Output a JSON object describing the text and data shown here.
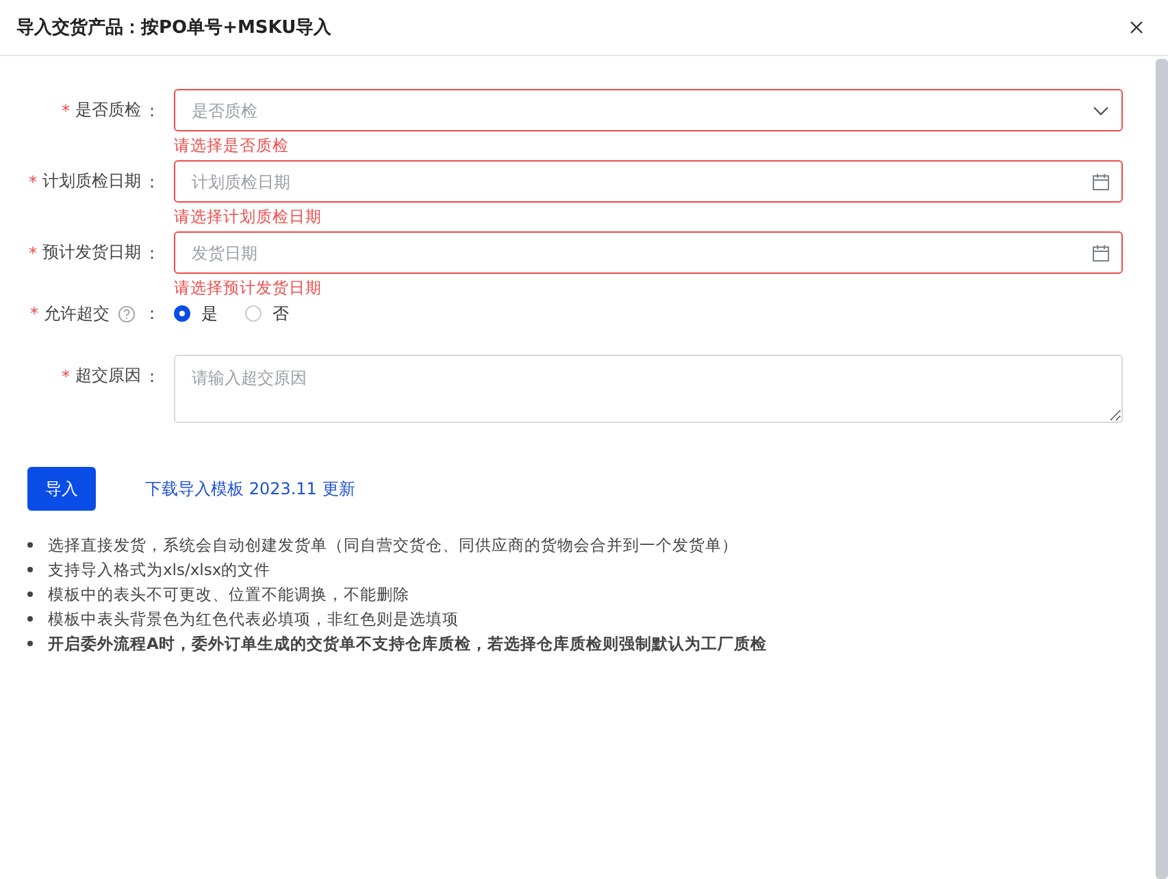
{
  "dialog": {
    "title": "导入交货产品：按PO单号+MSKU导入"
  },
  "fields": [
    {
      "kind": "select",
      "label": "是否质检",
      "colon": ":",
      "required_mark": "*",
      "placeholder": "是否质检",
      "error": "请选择是否质检"
    },
    {
      "kind": "date",
      "label": "计划质检日期",
      "colon": ":",
      "required_mark": "*",
      "placeholder": "计划质检日期",
      "error": "请选择计划质检日期"
    },
    {
      "kind": "date",
      "label": "预计发货日期",
      "colon": ":",
      "required_mark": "*",
      "placeholder": "发货日期",
      "error": "请选择预计发货日期"
    },
    {
      "kind": "radio",
      "label": "允许超交",
      "colon": ":",
      "required_mark": "*",
      "help": true,
      "options": [
        {
          "label": "是",
          "selected": true
        },
        {
          "label": "否",
          "selected": false
        }
      ]
    },
    {
      "kind": "textarea",
      "label": "超交原因",
      "colon": ":",
      "required_mark": "*",
      "placeholder": "请输入超交原因"
    }
  ],
  "import_button": "导入",
  "template_link": "下载导入模板 2023.11 更新",
  "notes": [
    {
      "text": "选择直接发货，系统会自动创建发货单（同自营交货仓、同供应商的货物会合并到一个发货单）",
      "bold": false
    },
    {
      "text": "支持导入格式为xls/xlsx的文件",
      "bold": false
    },
    {
      "text": "模板中的表头不可更改、位置不能调换，不能删除",
      "bold": false
    },
    {
      "text": "模板中表头背景色为红色代表必填项，非红色则是选填项",
      "bold": false
    },
    {
      "text": "开启委外流程A时，委外订单生成的交货单不支持仓库质检，若选择仓库质检则强制默认为工厂质检",
      "bold": true
    }
  ]
}
